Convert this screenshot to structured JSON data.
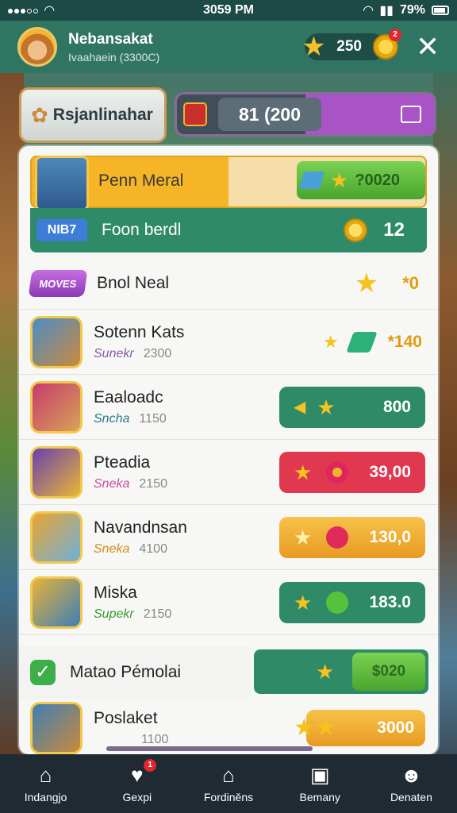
{
  "status_bar": {
    "time": "3059 PM",
    "battery": "79%"
  },
  "header": {
    "player_name": "Nebansakat",
    "player_sub": "Ivaahaein (3300C)",
    "coins": "250",
    "notif_count": "2"
  },
  "top": {
    "tab_label": "Rsjanlinahar",
    "amount": "81 (200"
  },
  "featured": {
    "title": "Penn Meral",
    "value": "?0020"
  },
  "featured_sub": {
    "tag": "NIB7",
    "title": "Foon berdl",
    "count": "12"
  },
  "moves": {
    "pill": "MOVES",
    "title": "Bnol Neal",
    "value": "*0"
  },
  "items": [
    {
      "name": "Sotenn Kats",
      "label": "Sunekr",
      "num": "2300",
      "value": "*140",
      "label_color": "#8b5aa8"
    },
    {
      "name": "Eaaloadc",
      "label": "Sncha",
      "num": "1150",
      "value": "800",
      "label_color": "#2a7a8a"
    },
    {
      "name": "Pteadia",
      "label": "Sneka",
      "num": "2150",
      "value": "39,00",
      "label_color": "#c44fa0"
    },
    {
      "name": "Navandnsan",
      "label": "Sneka",
      "num": "4100",
      "value": "130,0",
      "label_color": "#d48a16"
    },
    {
      "name": "Miska",
      "label": "Supekr",
      "num": "2150",
      "value": "183.0",
      "label_color": "#3a9a2e"
    }
  ],
  "footer_row": {
    "title": "Matao Pémolai",
    "value": "$020"
  },
  "last_row": {
    "name": "Poslaket",
    "num": "1100",
    "value": "3000"
  },
  "nav": [
    {
      "label": "Indangjo"
    },
    {
      "label": "Gexpi",
      "badge": "1"
    },
    {
      "label": "Fordiněns"
    },
    {
      "label": "Bemany"
    },
    {
      "label": "Denaten"
    }
  ]
}
